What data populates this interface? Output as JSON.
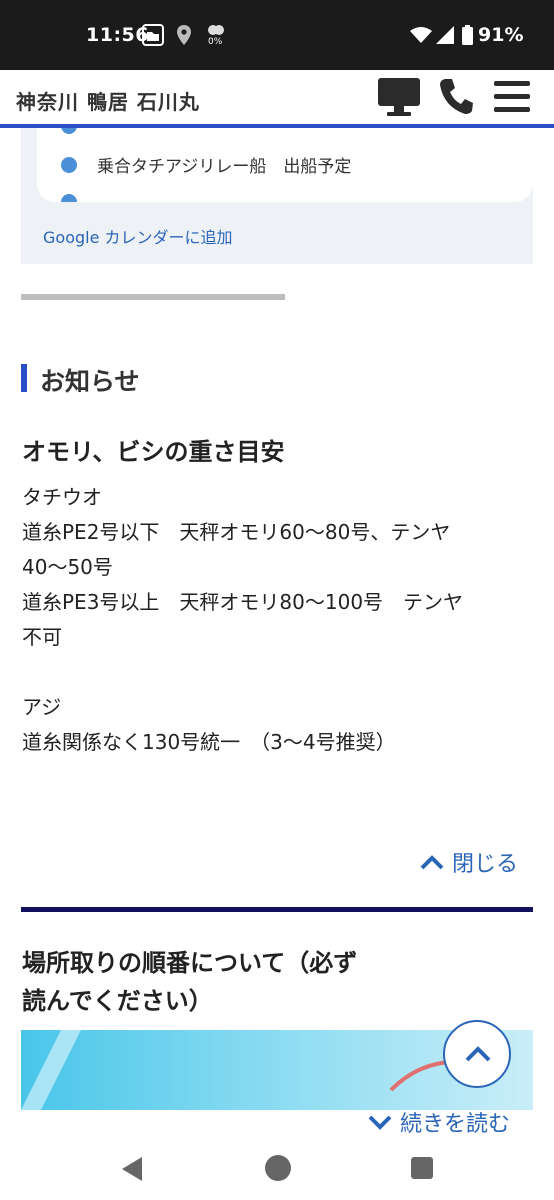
{
  "status_bar": {
    "time": "11:56",
    "weather_text": "0%",
    "battery": "91%"
  },
  "header": {
    "site_title": "神奈川 鴨居 石川丸",
    "icons": [
      "desktop-icon",
      "phone-icon",
      "menu-icon"
    ]
  },
  "calendar": {
    "items": [
      "乗合タチアジリレー船　出船予定"
    ],
    "add_link": "Google カレンダーに追加"
  },
  "notice_section": {
    "heading": "お知らせ"
  },
  "post": {
    "title": "オモリ、ビシの重さ目安",
    "lines": [
      "タチウオ",
      "道糸PE2号以下　天秤オモリ60〜80号、テンヤ",
      "40〜50号",
      "道糸PE3号以上　天秤オモリ80〜100号　テンヤ",
      "不可",
      "",
      "アジ",
      "道糸関係なく130号統一　（3〜4号推奨）"
    ],
    "close_label": "閉じる"
  },
  "post2": {
    "title_line1": "場所取りの順番について（必ず",
    "title_line2": "読んでください）",
    "more_label": "続きを読む"
  },
  "colors": {
    "accent_blue": "#2a4fc7",
    "link_blue": "#2a65b8",
    "navy": "#11115e",
    "dot_blue": "#4a90d9"
  }
}
